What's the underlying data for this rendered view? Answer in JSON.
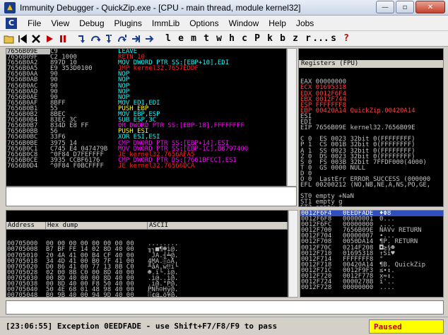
{
  "window": {
    "title": "Immunity Debugger - QuickZip.exe - [CPU - main thread, module kernel32]",
    "minimize_glyph": "—",
    "maximize_glyph": "▫",
    "close_glyph": "✕"
  },
  "menu": [
    "File",
    "View",
    "Debug",
    "Plugins",
    "ImmLib",
    "Options",
    "Window",
    "Help",
    "Jobs"
  ],
  "menu_logo": "C",
  "toolbar": {
    "buttons": [
      "open-icon",
      "restart-icon",
      "close-icon",
      "run-icon",
      "pause-icon",
      "step-into-icon",
      "step-over-icon",
      "trace-into-icon",
      "trace-over-icon",
      "execute-till-return-icon",
      "goto-icon"
    ],
    "letters": [
      "l",
      "e",
      "m",
      "t",
      "w",
      "h",
      "c",
      "P",
      "k",
      "b",
      "z",
      "r",
      "...",
      "s",
      "?"
    ]
  },
  "cpu": {
    "rows": [
      {
        "addr": "7656B09E",
        "hex": "C9",
        "dis": "LEAVE",
        "color": "cyan",
        "sel": true
      },
      {
        "addr": "7656B09F",
        "hex": "C2 1000",
        "dis": "RETN 10",
        "color": "red"
      },
      {
        "addr": "7656B0A2",
        "hex": "897D 10",
        "dis": "MOV DWORD PTR SS:[EBP+10],EDI",
        "color": "cyan"
      },
      {
        "addr": "7656B0A5",
        "hex": "E9 353D0100",
        "dis": "JMP kernel32.7657EDDF",
        "color": "red"
      },
      {
        "addr": "7656B0AA",
        "hex": "90",
        "dis": "NOP",
        "color": "cyan"
      },
      {
        "addr": "7656B0AB",
        "hex": "90",
        "dis": "NOP",
        "color": "cyan"
      },
      {
        "addr": "7656B0AC",
        "hex": "90",
        "dis": "NOP",
        "color": "cyan"
      },
      {
        "addr": "7656B0AD",
        "hex": "90",
        "dis": "NOP",
        "color": "cyan"
      },
      {
        "addr": "7656B0AE",
        "hex": "90",
        "dis": "NOP",
        "color": "cyan"
      },
      {
        "addr": "7656B0AF",
        "hex": "8BFF",
        "dis": "MOV EDI,EDI",
        "color": "cyan"
      },
      {
        "addr": "7656B0B1",
        "hex": "55",
        "dis": "PUSH EBP",
        "color": "yellow"
      },
      {
        "addr": "7656B0B2",
        "hex": "8BEC",
        "dis": "MOV EBP,ESP",
        "color": "cyan"
      },
      {
        "addr": "7656B0B4",
        "hex": "83EC 3C",
        "dis": "SUB ESP,3C",
        "color": "cyan"
      },
      {
        "addr": "7656B0B7",
        "hex": "834D E8 FF",
        "dis": "OR DWORD PTR SS:[EBP-18],FFFFFFFF",
        "color": "magenta"
      },
      {
        "addr": "7656B0BB",
        "hex": "56",
        "dis": "PUSH ESI",
        "color": "yellow"
      },
      {
        "addr": "7656B0BC",
        "hex": "33F6",
        "dis": "XOR ESI,ESI",
        "color": "cyan"
      },
      {
        "addr": "7656B0BE",
        "hex": "3975 14",
        "dis": "CMP DWORD PTR SS:[EBP+14],ESI",
        "color": "magenta"
      },
      {
        "addr": "7656B0C1",
        "hex": "C745 E4 047479B",
        "dis": "MOV DWORD PTR SS:[EBP-1C],B8797400",
        "color": "magenta"
      },
      {
        "addr": "7656B0C8",
        "hex": "^0F84 D7FEFFFF",
        "dis": "JE kernel32.7656AFA5",
        "color": "red"
      },
      {
        "addr": "7656B0CE",
        "hex": "3935 CCBF6176",
        "dis": "CMP DWORD PTR DS:[7661BFCC],ESI",
        "color": "magenta"
      },
      {
        "addr": "7656B0D4",
        "hex": "^0F84 F0BCFFFF",
        "dis": "JE kernel32.76566DCA",
        "color": "red"
      }
    ]
  },
  "registers": {
    "title": "Registers (FPU)",
    "rows": [
      {
        "text": "EAX 00000000",
        "changed": false
      },
      {
        "text": "ECX 01695318",
        "changed": true
      },
      {
        "text": "EDX 0012F6F4",
        "changed": true
      },
      {
        "text": "EBX 0012F744",
        "changed": true
      },
      {
        "text": "ESP FFFFFFF8",
        "changed": true
      },
      {
        "text": "EBP 00420A14 QuickZip.00420A14",
        "changed": true
      },
      {
        "text": "ESI",
        "changed": false
      },
      {
        "text": "EDI",
        "changed": false
      },
      {
        "text": "EIP 7656B09E kernel32.7656B09E",
        "changed": false
      },
      {
        "text": "",
        "changed": false
      },
      {
        "text": "C 0  ES 0023 32bit 0(FFFFFFFF)",
        "changed": false
      },
      {
        "text": "P 1  CS 001B 32bit 0(FFFFFFFF)",
        "changed": false
      },
      {
        "text": "A 1  SS 0023 32bit 0(FFFFFFFF)",
        "changed": false
      },
      {
        "text": "Z 0  DS 0023 32bit 0(FFFFFFFF)",
        "changed": false
      },
      {
        "text": "S 0  FS 003B 32bit 7FFDF000(4000)",
        "changed": false
      },
      {
        "text": "T 0  GS 0000 NULL",
        "changed": false
      },
      {
        "text": "D 0",
        "changed": false
      },
      {
        "text": "O 0  LastErr ERROR_SUCCESS (000000",
        "changed": false
      },
      {
        "text": "EFL 00200212 (NO,NB,NE,A,NS,PO,GE,",
        "changed": false
      },
      {
        "text": "",
        "changed": false
      },
      {
        "text": "ST0 empty +NaN",
        "changed": false
      },
      {
        "text": "ST1 empty g",
        "changed": false
      },
      {
        "text": "ST2 empty g",
        "changed": false
      },
      {
        "text": "ST3 empty +NaN",
        "changed": false
      },
      {
        "text": "ST4 empty g",
        "changed": false
      },
      {
        "text": "ST5 empty g",
        "changed": false
      }
    ]
  },
  "dump": {
    "headers": [
      "Address",
      "Hex dump",
      "ASCII"
    ],
    "rows": [
      {
        "addr": "00705000",
        "hex": "00 00 00 00 00 00 00 00",
        "ascii": "........"
      },
      {
        "addr": "00705008",
        "hex": "B7 BF FE 14 02 8D 40 00",
        "ascii": "╖┐■¶☻ì@."
      },
      {
        "addr": "00705010",
        "hex": "20 4A 41 00 B4 CF 40 00",
        "ascii": " JA.┤╧@."
      },
      {
        "addr": "00705018",
        "hex": "34 4D 41 00 B0 7F 41 00",
        "ascii": "4MA.░⌂A."
      },
      {
        "addr": "00705020",
        "hex": "D0 86 41 00 77 13 8B C0",
        "ascii": "╨åA.w‼ï└"
      },
      {
        "addr": "00705028",
        "hex": "02 00 8B C0 00 8D 40 00",
        "ascii": "☻.ï└.ì@."
      },
      {
        "addr": "00705030",
        "hex": "00 8D 40 00 00 8D 40 00",
        "ascii": ".ì@..ì@."
      },
      {
        "addr": "00705038",
        "hex": "00 8D 40 00 F8 50 40 00",
        "ascii": ".ì@.°P@."
      },
      {
        "addr": "00705040",
        "hex": "50 4E 68 01 48 98 40 00",
        "ascii": "PNh☺Hÿ@."
      },
      {
        "addr": "00705048",
        "hex": "B0 9B 40 00 94 9D 40 00",
        "ascii": "░¢@.ö¥@."
      },
      {
        "addr": "00705050",
        "hex": "CD CE DB DB DA D9 CA DC",
        "ascii": "═╬██┌┘╩▄"
      },
      {
        "addr": "00705058",
        "hex": "CD CE DB DB DA D9 CA DC",
        "ascii": "═╬██┌┘╩▄"
      }
    ]
  },
  "stack": {
    "rows": [
      {
        "addr": "0012F6F4",
        "val": "0EEDFADE",
        "com": "♦Φ8",
        "sel": true
      },
      {
        "addr": "0012F6F8",
        "val": "00000001",
        "com": "0..."
      },
      {
        "addr": "0012F6FC",
        "val": "00000000",
        "com": "...."
      },
      {
        "addr": "0012F700",
        "val": "7656B09E",
        "com": "ÑAVv RETURN"
      },
      {
        "addr": "0012F704",
        "val": "00000007",
        "com": "•..."
      },
      {
        "addr": "0012F708",
        "val": "0050DA14",
        "com": "¶P. RETURN"
      },
      {
        "addr": "0012F70C",
        "val": "0214F208",
        "com": "◘≥§☻"
      },
      {
        "addr": "0012F710",
        "val": "01695318",
        "com": "↑Si♥"
      },
      {
        "addr": "0012F714",
        "val": "FFFFFFF8",
        "com": "°   "
      },
      {
        "addr": "0012F718",
        "val": "00420A14",
        "com": "¶B. QuickZip"
      },
      {
        "addr": "0012F71C",
        "val": "0012F9F3",
        "com": "≤∙↕."
      },
      {
        "addr": "0012F720",
        "val": "0012F778",
        "com": "x≈↕."
      },
      {
        "addr": "0012F724",
        "val": "0000278B",
        "com": "ï'.."
      },
      {
        "addr": "0012F728",
        "val": "00000000",
        "com": "...."
      }
    ]
  },
  "status": {
    "message": "[23:06:55] Exception 0EEDFADE - use Shift+F7/F8/F9 to pass",
    "state": "Paused"
  }
}
